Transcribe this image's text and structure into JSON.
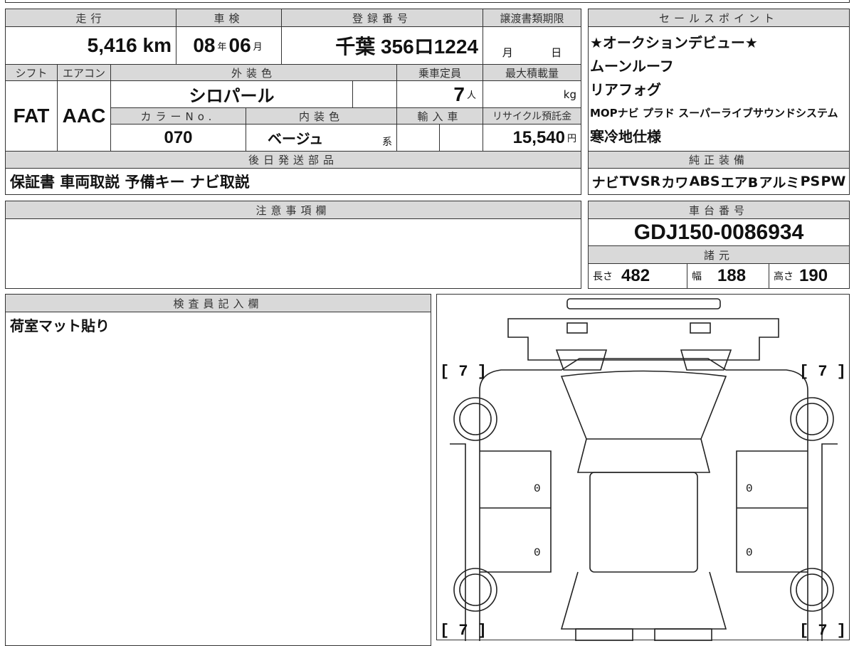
{
  "odometer": {
    "label": "走行",
    "value": "5,416",
    "unit": "km"
  },
  "inspection": {
    "label": "車検",
    "year": "08",
    "year_unit": "年",
    "month": "06",
    "month_unit": "月"
  },
  "registration": {
    "label": "登録番号",
    "value": "千葉 356ロ1224"
  },
  "transfer_deadline": {
    "label": "譲渡書類期限",
    "month_unit": "月",
    "day_unit": "日"
  },
  "shift": {
    "label": "シフト",
    "value": "FAT"
  },
  "aircon": {
    "label": "エアコン",
    "value": "AAC"
  },
  "exterior_color": {
    "label": "外装色",
    "value": "シロパール"
  },
  "capacity": {
    "label": "乗車定員",
    "value": "7",
    "unit": "人"
  },
  "max_load": {
    "label": "最大積載量",
    "unit": "kg"
  },
  "color_no": {
    "label": "カラーNo.",
    "value": "070"
  },
  "interior_color": {
    "label": "内装色",
    "value": "ベージュ",
    "suffix": "系"
  },
  "import": {
    "label": "輸入車"
  },
  "recycle": {
    "label": "リサイクル預託金",
    "value": "15,540",
    "unit": "円"
  },
  "later_parts": {
    "label": "後日発送部品",
    "value": "保証書 車両取説 予備キー ナビ取説"
  },
  "sales_points": {
    "label": "セールスポイント",
    "items": [
      "★オークションデビュー★",
      "ムーンルーフ",
      "リアフォグ",
      "MOPナビ プラド スーパーライブサウンドシステム",
      "寒冷地仕様"
    ]
  },
  "equipment": {
    "label": "純正装備",
    "items": [
      "ナビ",
      "TV",
      "SR",
      "カワ",
      "ABS",
      "エアB",
      "アルミ",
      "PS",
      "PW"
    ]
  },
  "notes": {
    "label": "注意事項欄",
    "value": ""
  },
  "chassis": {
    "label": "車台番号",
    "value": "GDJ150-0086934"
  },
  "specs": {
    "label": "諸元",
    "length_label": "長さ",
    "length": "482",
    "width_label": "幅",
    "width": "188",
    "height_label": "高さ",
    "height": "190"
  },
  "inspector": {
    "label": "検査員記入欄",
    "value": "荷室マット貼り"
  },
  "diagram": {
    "corner_labels": [
      "[ 7 ]",
      "[ 7 ]",
      "[ 7 ]",
      "[ 7 ]"
    ],
    "door_marks": [
      "0",
      "0",
      "0",
      "0"
    ]
  }
}
